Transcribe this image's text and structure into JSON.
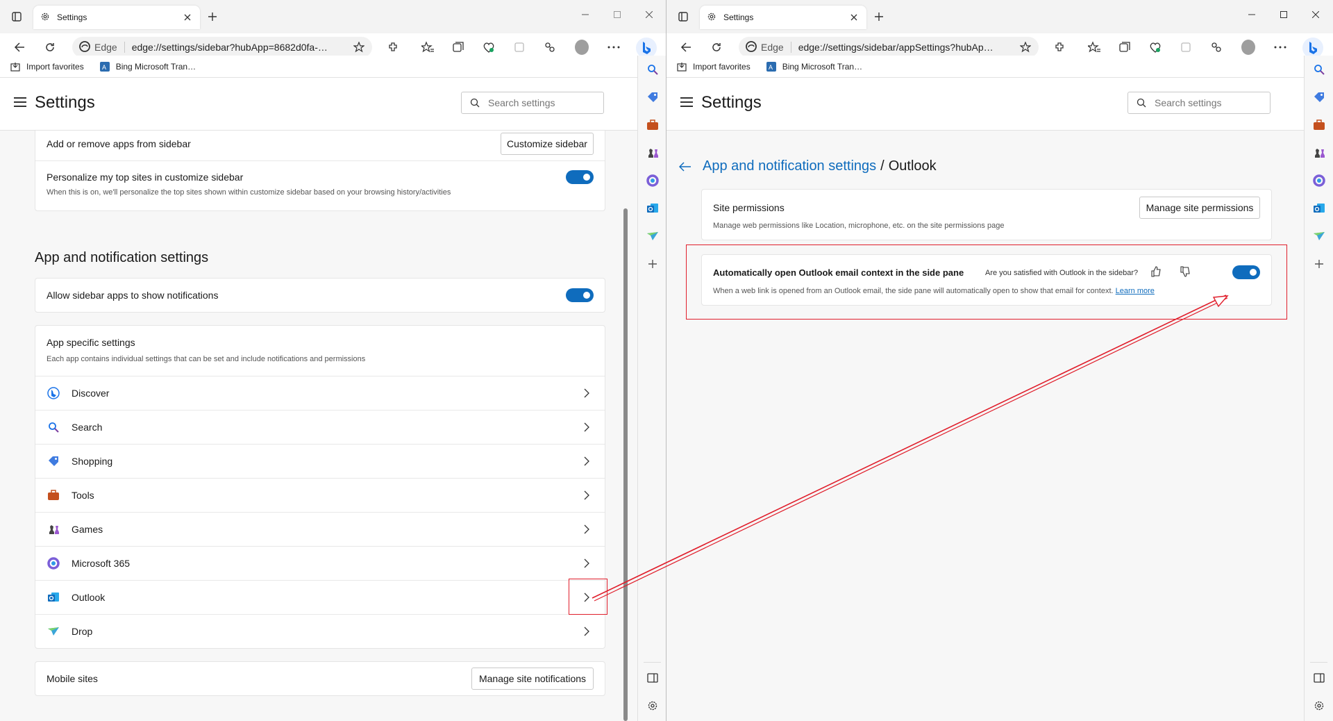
{
  "left": {
    "tab_title": "Settings",
    "address_site": "Edge",
    "address_url": "edge://settings/sidebar?hubApp=8682d0fa-…",
    "favorites": [
      "Import favorites",
      "Bing Microsoft Tran…"
    ],
    "header_title": "Settings",
    "search_placeholder": "Search settings",
    "customize": {
      "label": "Add or remove apps from sidebar",
      "button": "Customize sidebar"
    },
    "personalize": {
      "title": "Personalize my top sites in customize sidebar",
      "desc": "When this is on, we'll personalize the top sites shown within customize sidebar based on your browsing history/activities",
      "on": true
    },
    "section_title": "App and notification settings",
    "allow_notifications": {
      "label": "Allow sidebar apps to show notifications",
      "on": true
    },
    "app_specific": {
      "title": "App specific settings",
      "desc": "Each app contains individual settings that can be set and include notifications and permissions",
      "apps": [
        "Discover",
        "Search",
        "Shopping",
        "Tools",
        "Games",
        "Microsoft 365",
        "Outlook",
        "Drop"
      ]
    },
    "mobile_sites": {
      "label": "Mobile sites",
      "button": "Manage site notifications"
    }
  },
  "right": {
    "tab_title": "Settings",
    "address_site": "Edge",
    "address_url": "edge://settings/sidebar/appSettings?hubAp…",
    "favorites": [
      "Import favorites",
      "Bing Microsoft Tran…"
    ],
    "header_title": "Settings",
    "search_placeholder": "Search settings",
    "breadcrumb_parent": "App and notification settings",
    "breadcrumb_sep": "/",
    "breadcrumb_current": "Outlook",
    "site_permissions": {
      "title": "Site permissions",
      "desc": "Manage web permissions like Location, microphone, etc. on the site permissions page",
      "button": "Manage site permissions"
    },
    "outlook_setting": {
      "title": "Automatically open Outlook email context in the side pane",
      "feedback": "Are you satisfied with Outlook in the sidebar?",
      "desc": "When a web link is opened from an Outlook email, the side pane will automatically open to show that email for context.",
      "learn_more": "Learn more",
      "on": true
    }
  },
  "colors": {
    "accent": "#0f6cbd",
    "annotation": "#e01e2b"
  }
}
